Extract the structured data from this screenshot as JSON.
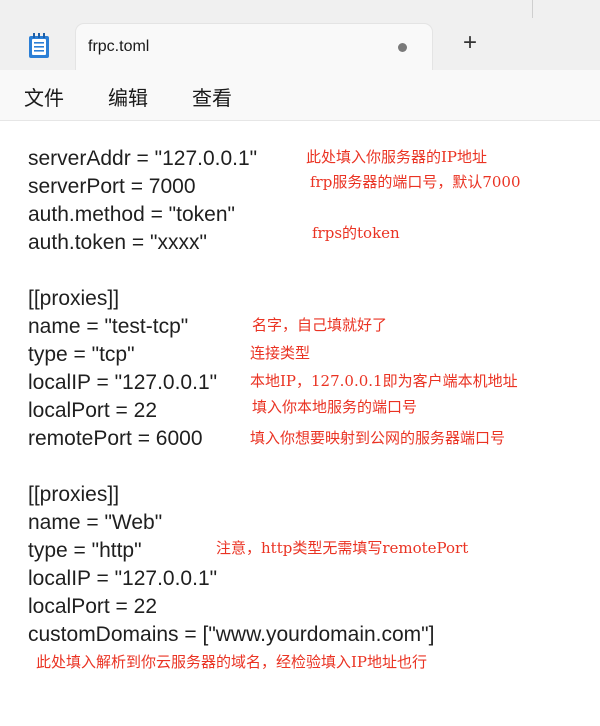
{
  "window": {
    "app_icon": "notepad-icon",
    "tab_title": "frpc.toml",
    "tab_status_icon": "unsaved-dot-icon",
    "new_tab_label": "+"
  },
  "menu": {
    "file": "文件",
    "edit": "编辑",
    "view": "查看"
  },
  "code_lines": [
    "serverAddr = \"127.0.0.1\"",
    "serverPort = 7000",
    "auth.method = \"token\"",
    "auth.token = \"xxxx\"",
    "",
    "[[proxies]]",
    "name = \"test-tcp\"",
    "type = \"tcp\"",
    "localIP = \"127.0.0.1\"",
    "localPort = 22",
    "remotePort = 6000",
    "",
    "[[proxies]]",
    "name = \"Web\"",
    "type = \"http\"",
    "localIP = \"127.0.0.1\"",
    "localPort = 22",
    "customDomains = [\"www.yourdomain.com\"]"
  ],
  "annotations": {
    "server_addr": "此处填入你服务器的IP地址",
    "server_port": "frp服务器的端口号，默认7000",
    "token": "frps的token",
    "name": "名字，自己填就好了",
    "type": "连接类型",
    "local_ip": "本地IP，127.0.0.1即为客户端本机地址",
    "local_port": "填入你本地服务的端口号",
    "remote_port": "填入你想要映射到公网的服务器端口号",
    "http_note": "注意，http类型无需填写remotePort",
    "domain_note": "此处填入解析到你云服务器的域名，经检验填入IP地址也行"
  },
  "colors": {
    "annotation": "#ea3323",
    "titlebar_bg": "#f0f0f0",
    "editor_bg": "#ffffff",
    "text": "#1f1f1f"
  }
}
